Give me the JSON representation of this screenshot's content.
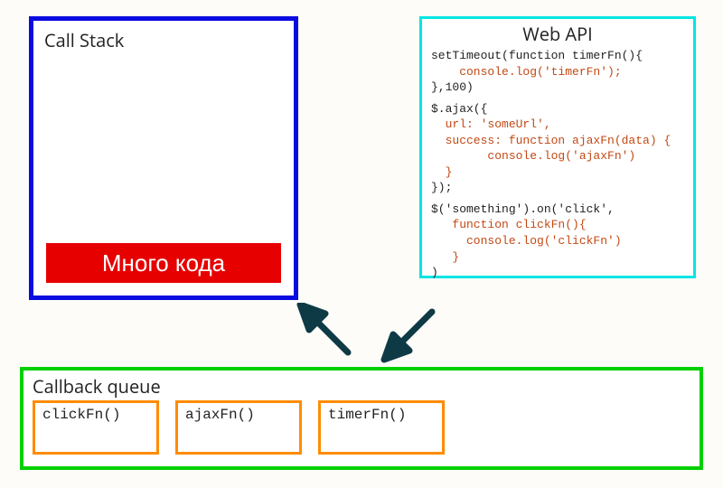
{
  "call_stack": {
    "title": "Call Stack",
    "item_label": "Много кода"
  },
  "web_api": {
    "title": "Web API",
    "blocks": [
      {
        "outer_pre": "setTimeout(function timerFn(){",
        "inner": "    console.log('timerFn');",
        "outer_post": "},100)"
      },
      {
        "outer_pre": "$.ajax({",
        "inner": "  url: 'someUrl',\n  success: function ajaxFn(data) {\n        console.log('ajaxFn')\n  }",
        "outer_post": "});"
      },
      {
        "outer_pre": "$('something').on('click',",
        "inner": "   function clickFn(){\n     console.log('clickFn')\n   }",
        "outer_post": ")"
      }
    ]
  },
  "callback_queue": {
    "title": "Callback queue",
    "items": [
      "clickFn()",
      "ajaxFn()",
      "timerFn()"
    ]
  },
  "colors": {
    "callstack_border": "#0a0be0",
    "callstack_item_bg": "#e60000",
    "webapi_border": "#00e5e5",
    "queue_border": "#00d000",
    "queue_item_border": "#ff8c00",
    "code_inner": "#c24914",
    "arrow": "#0e3a46"
  }
}
